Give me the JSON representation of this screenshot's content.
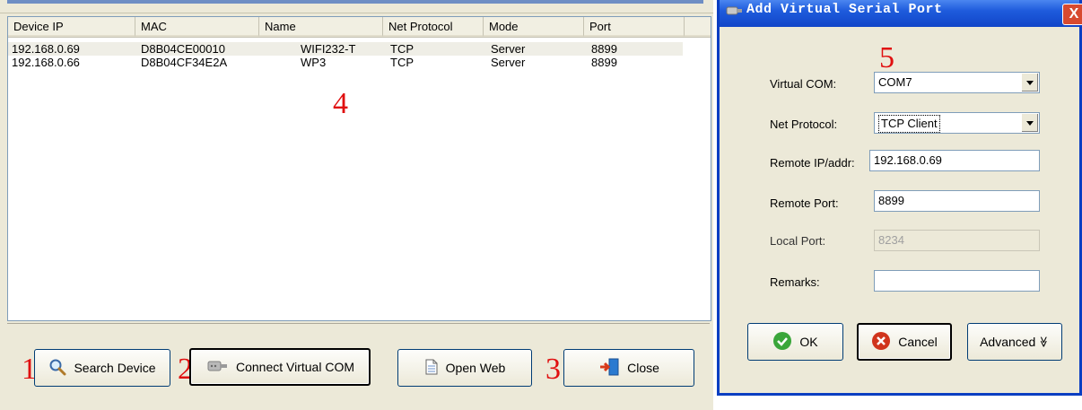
{
  "device_list": {
    "columns": [
      "Device IP",
      "MAC",
      "Name",
      "Net Protocol",
      "Mode",
      "Port"
    ],
    "rows": [
      {
        "ip": "192.168.0.69",
        "mac": "D8B04CE00010",
        "name": "WIFI232-T",
        "protocol": "TCP",
        "mode": "Server",
        "port": "8899"
      },
      {
        "ip": "192.168.0.66",
        "mac": "D8B04CF34E2A",
        "name": "WP3",
        "protocol": "TCP",
        "mode": "Server",
        "port": "8899"
      }
    ]
  },
  "toolbar": {
    "search_label": "Search Device",
    "connect_label": "Connect Virtual COM",
    "open_web_label": "Open Web",
    "close_label": "Close"
  },
  "annotations": {
    "n1": "1",
    "n2": "2",
    "n3": "3",
    "n4": "4",
    "n5": "5"
  },
  "dialog": {
    "title": "Add Virtual Serial Port",
    "close_glyph": "X",
    "virtual_com_label": "Virtual COM:",
    "virtual_com_value": "COM7",
    "net_protocol_label": "Net Protocol:",
    "net_protocol_value": "TCP Client",
    "remote_ip_label": "Remote IP/addr:",
    "remote_ip_value": "192.168.0.69",
    "remote_port_label": "Remote Port:",
    "remote_port_value": "8899",
    "local_port_label": "Local Port:",
    "local_port_value": "8234",
    "remarks_label": "Remarks:",
    "remarks_value": "",
    "ok_label": "OK",
    "cancel_label": "Cancel",
    "advanced_label": "Advanced",
    "advanced_glyph": "≫"
  },
  "colors": {
    "titlebar": "#1e5bdc",
    "annotation_red": "#e01010",
    "ok_green": "#3aa63a",
    "cancel_red": "#d0341c"
  },
  "icons": [
    "magnifier-icon",
    "serial-port-icon",
    "document-icon",
    "exit-door-icon",
    "check-icon",
    "cancel-icon",
    "app-icon",
    "dropdown-arrow-icon"
  ]
}
